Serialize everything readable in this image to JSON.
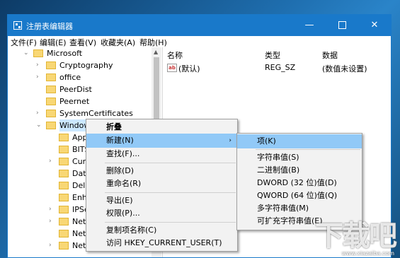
{
  "window": {
    "title": "注册表编辑器",
    "minimize_glyph": "—",
    "maximize_glyph": "",
    "close_glyph": "✕"
  },
  "menubar": [
    "文件(F)",
    "编辑(E)",
    "查看(V)",
    "收藏夹(A)",
    "帮助(H)"
  ],
  "tree": {
    "items": [
      {
        "label": "Microsoft",
        "arrow": "⌄"
      },
      {
        "label": "Cryptography",
        "arrow": "›"
      },
      {
        "label": "office",
        "arrow": "›"
      },
      {
        "label": "PeerDist",
        "arrow": ""
      },
      {
        "label": "Peernet",
        "arrow": ""
      },
      {
        "label": "SystemCertificates",
        "arrow": "›"
      },
      {
        "label": "Windows",
        "arrow": "⌄"
      },
      {
        "label": "Appx",
        "arrow": ""
      },
      {
        "label": "BITS",
        "arrow": ""
      },
      {
        "label": "Curre",
        "arrow": "›"
      },
      {
        "label": "Data",
        "arrow": ""
      },
      {
        "label": "Delive",
        "arrow": ""
      },
      {
        "label": "Enha",
        "arrow": ""
      },
      {
        "label": "IPSec",
        "arrow": "›"
      },
      {
        "label": "Netw",
        "arrow": "›"
      },
      {
        "label": "Netw",
        "arrow": ""
      },
      {
        "label": "Netw",
        "arrow": "›"
      }
    ]
  },
  "list": {
    "headers": {
      "name": "名称",
      "type": "类型",
      "data": "数据"
    },
    "rows": [
      {
        "icon": "ab",
        "name": "(默认)",
        "type": "REG_SZ",
        "data": "(数值未设置)"
      }
    ]
  },
  "context_menu": {
    "items": [
      "折叠",
      "新建(N)",
      "查找(F)...",
      "删除(D)",
      "重命名(R)",
      "导出(E)",
      "权限(P)...",
      "复制项名称(C)",
      "访问 HKEY_CURRENT_USER(T)"
    ],
    "submenu_arrow": "›"
  },
  "submenu": {
    "items": [
      "项(K)",
      "字符串值(S)",
      "二进制值(B)",
      "DWORD (32 位)值(D)",
      "QWORD (64 位)值(Q)",
      "多字符串值(M)",
      "可扩充字符串值(E)"
    ]
  },
  "watermark": {
    "text": "下载吧",
    "url": "www.xiazaiba.com"
  },
  "colors": {
    "titlebar": "#1979ca",
    "highlight": "#91c9f7",
    "tree_selection": "#cce8ff",
    "folder": "#f8d775"
  }
}
